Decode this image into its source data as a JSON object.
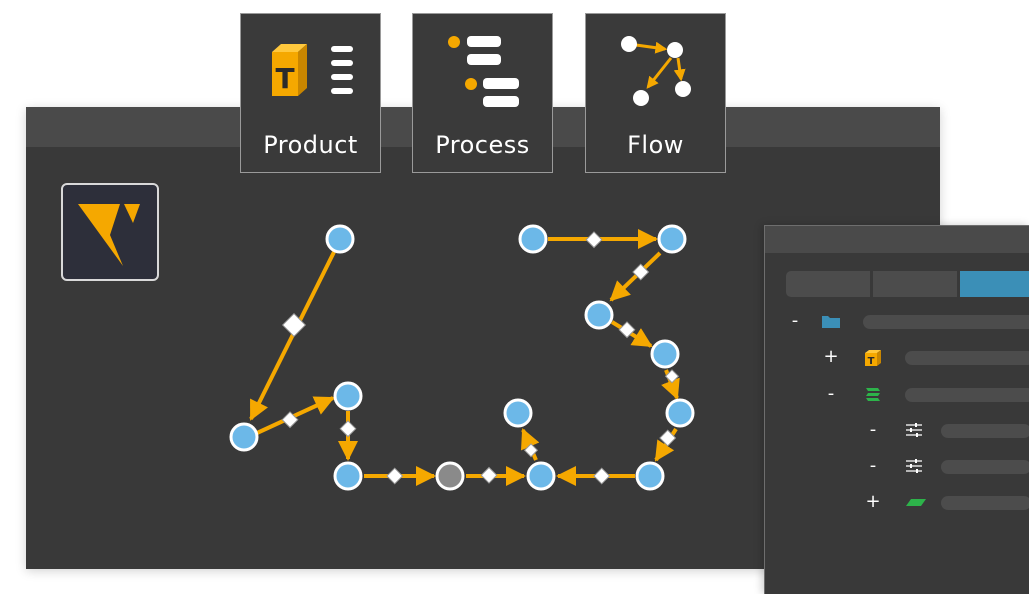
{
  "mode_tabs": [
    {
      "label": "Product",
      "icon": "product-icon"
    },
    {
      "label": "Process",
      "icon": "process-icon"
    },
    {
      "label": "Flow",
      "icon": "flow-icon"
    }
  ],
  "logo": {
    "icon": "v-logo-icon",
    "color": "#f5a800"
  },
  "colors": {
    "accent_orange": "#f5a800",
    "node_blue": "#6cb8e8",
    "node_gray": "#8a8a8a",
    "window_bg": "#393939",
    "titlebar_bg": "#4a4a4a",
    "active_tab": "#3b8fb7",
    "green": "#2db34a"
  },
  "tree_panel": {
    "tabs": [
      "",
      "",
      ""
    ],
    "active_tab_index": 2,
    "rows": [
      {
        "toggle": "-",
        "icon": "folder-icon"
      },
      {
        "toggle": "+",
        "icon": "product-box-icon"
      },
      {
        "toggle": "-",
        "icon": "stack-icon"
      },
      {
        "toggle": "-",
        "icon": "sliders-icon"
      },
      {
        "toggle": "-",
        "icon": "sliders-icon"
      },
      {
        "toggle": "+",
        "icon": "parallelogram-icon"
      }
    ]
  }
}
